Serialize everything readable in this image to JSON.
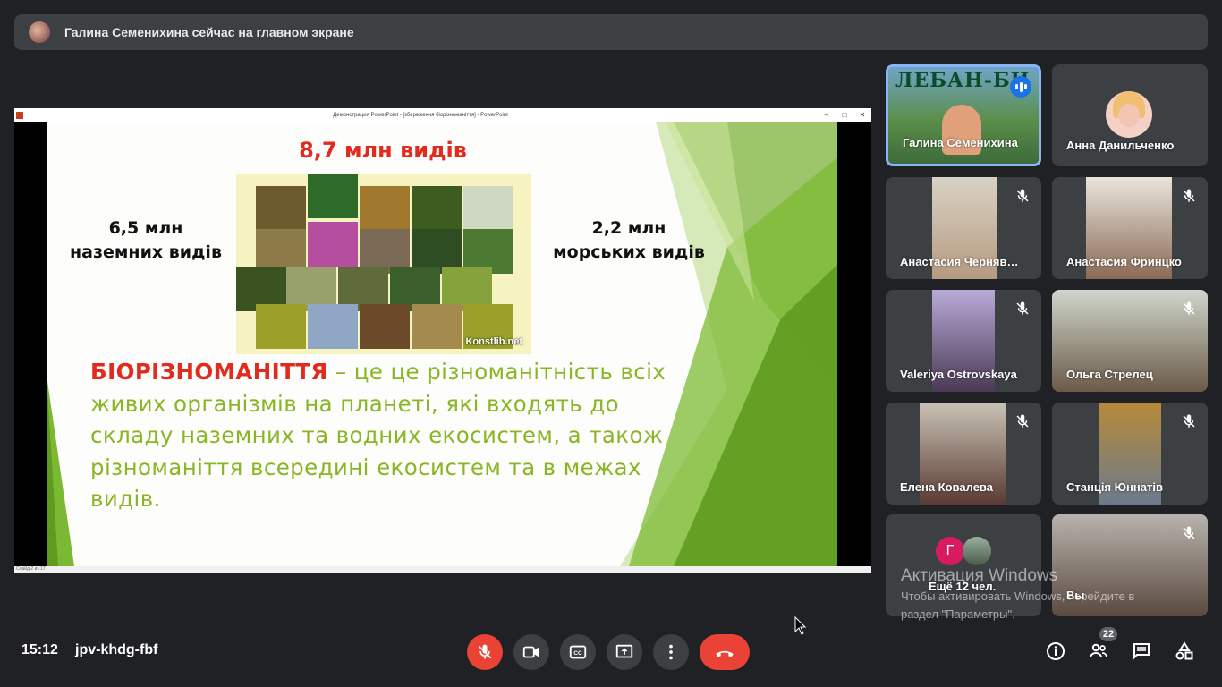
{
  "banner": {
    "text": "Галина Семенихина сейчас на главном экране"
  },
  "presentation": {
    "window_title": "Демонстрация PowerPoint - [збереження біорізноманіття] - PowerPoint",
    "window_controls": [
      "–",
      "□",
      "✕"
    ],
    "status": "Слайд 2 из 17",
    "slide": {
      "title": "8,7 млн видів",
      "land_line1": "6,5 млн",
      "land_line2": "наземних видів",
      "sea_line1": "2,2 млн",
      "sea_line2": "морських видів",
      "collage_watermark": "Konstlib.net",
      "term": "БІОРІЗНОМАНІТТЯ",
      "definition": " – це це різноманітність всіх живих організмів на планеті, які входять до складу наземних та водних екосистем, а також різноманіття всередині екосистем та в межах видів."
    }
  },
  "participants": [
    {
      "name": "Галина Семенихина",
      "muted": false,
      "speaking": true,
      "pinned": true
    },
    {
      "name": "Анна Данильченко",
      "muted": false
    },
    {
      "name": "Анастасия Черняв…",
      "muted": true
    },
    {
      "name": "Анастасия Фринцко",
      "muted": true
    },
    {
      "name": "Valeriya Ostrovskaya",
      "muted": true
    },
    {
      "name": "Ольга Стрелец",
      "muted": true
    },
    {
      "name": "Елена Ковалева",
      "muted": true
    },
    {
      "name": "Станція Юннатів",
      "muted": true
    },
    {
      "name": "Вы",
      "muted": true
    }
  ],
  "galina_bg_text": "ЛЕБАН-БИ",
  "more": {
    "label": "Ещё 12 чел.",
    "initial": "Г"
  },
  "windows_activation": {
    "line1": "Активация Windows",
    "line2": "Чтобы активировать Windows, перейдите в",
    "line3": "раздел \"Параметры\"."
  },
  "bottom": {
    "time": "15:12",
    "meeting_code": "jpv-khdg-fbf",
    "participant_count": "22"
  },
  "colors": {
    "accent_red": "#ea4335",
    "slide_green": "#8ab525",
    "slide_red": "#e12b1e",
    "active_border": "#8ab4f8"
  }
}
